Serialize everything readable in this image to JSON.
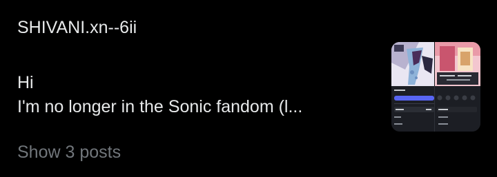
{
  "post": {
    "author": "SHIVANI.xn--6ii",
    "lines": [
      "Hi",
      "I'm no longer in the Sonic fandom (l..."
    ],
    "show_more": "Show 3 posts"
  },
  "colors": {
    "background": "#000000",
    "text": "#e7e9ea",
    "muted": "#71767b",
    "thumb_accent": "#5865f2"
  },
  "thumbnail": {
    "icon": "media-preview-icon"
  }
}
